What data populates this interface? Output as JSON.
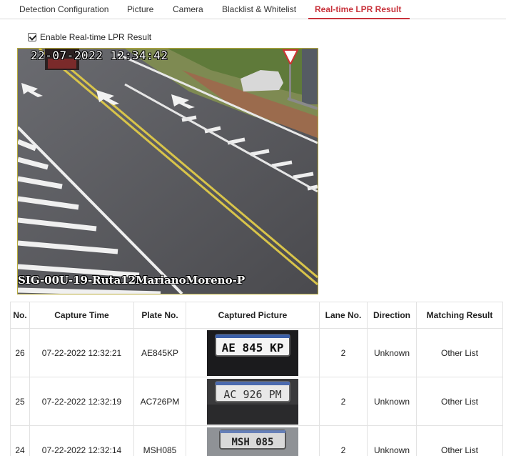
{
  "tabs": [
    {
      "label": "Detection Configuration",
      "active": false
    },
    {
      "label": "Picture",
      "active": false
    },
    {
      "label": "Camera",
      "active": false
    },
    {
      "label": "Blacklist & Whitelist",
      "active": false
    },
    {
      "label": "Real-time LPR Result",
      "active": true
    }
  ],
  "enable_lpr": {
    "label": "Enable Real-time LPR Result",
    "checked": true
  },
  "video": {
    "timestamp": "22-07-2022 12:34:42",
    "channel_name": "SIG-00U-19-Ruta12MarianoMoreno-P"
  },
  "table": {
    "headers": [
      "No.",
      "Capture Time",
      "Plate No.",
      "Captured Picture",
      "Lane No.",
      "Direction",
      "Matching Result"
    ],
    "rows": [
      {
        "no": "26",
        "time": "07-22-2022 12:32:21",
        "plate": "AE845KP",
        "picture_text": "AE 845 KP",
        "lane": "2",
        "direction": "Unknown",
        "match": "Other List"
      },
      {
        "no": "25",
        "time": "07-22-2022 12:32:19",
        "plate": "AC726PM",
        "picture_text": "AC 926 PM",
        "lane": "2",
        "direction": "Unknown",
        "match": "Other List"
      },
      {
        "no": "24",
        "time": "07-22-2022 12:32:14",
        "plate": "MSH085",
        "picture_text": "MSH 085",
        "lane": "2",
        "direction": "Unknown",
        "match": "Other List"
      }
    ]
  },
  "colors": {
    "accent": "#c8323b",
    "video_border": "#b7aa3a"
  }
}
